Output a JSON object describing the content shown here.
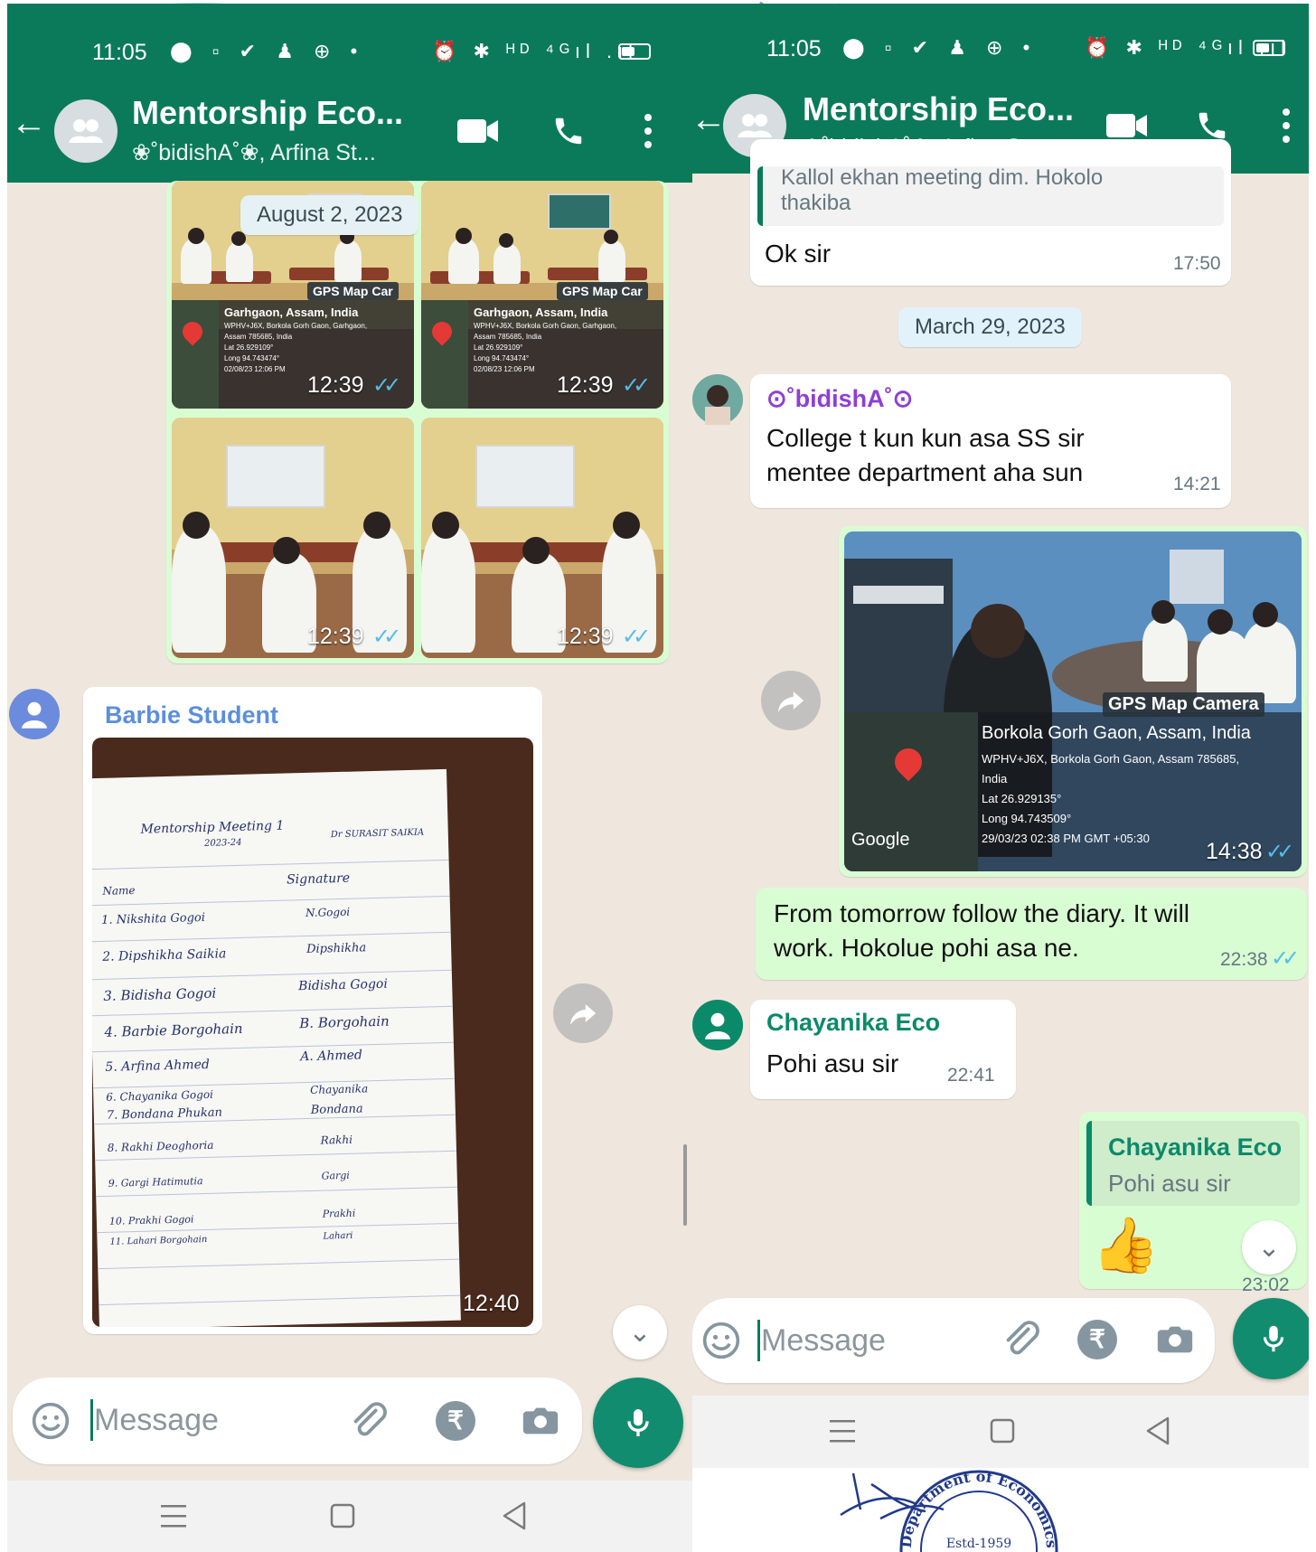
{
  "status": {
    "time": "11:05",
    "icons_left": "⬤ ▫ ✔ ♟ ⊕ •",
    "icons_right": "⏰ ✱ ᴴᴰ ⁴ᴳıl .ıl"
  },
  "chat": {
    "title": "Mentorship Eco...",
    "subtitle": "❀˚bidishA˚❀, Arfina St..."
  },
  "left": {
    "date_chip": "August 2, 2023",
    "photos": [
      {
        "time": "12:39",
        "gps_label": "GPS Map Car",
        "place": "Garhgaon, Assam, India",
        "line1": "WPHV+J6X, Borkola Gorh Gaon, Garhgaon,",
        "line2": "Assam 785685, India",
        "lat": "Lat 26.929109°",
        "long": "Long 94.743474°",
        "stamp": "02/08/23 12:06 PM"
      },
      {
        "time": "12:39",
        "gps_label": "GPS Map Car",
        "place": "Garhgaon, Assam, India",
        "line1": "WPHV+J6X, Borkola Gorh Gaon, Garhgaon,",
        "line2": "Assam 785685, India",
        "lat": "Lat 26.929109°",
        "long": "Long 94.743474°",
        "stamp": "02/08/23 12:06 PM"
      },
      {
        "time": "12:39"
      },
      {
        "time": "12:39"
      }
    ],
    "barbie": {
      "sender": "Barbie Student",
      "time": "12:40",
      "sheet": {
        "heading": "Mentorship Meeting 1",
        "year": "2023-24",
        "teacher": "Dr SURASIT SAIKIA",
        "col_name": "Name",
        "col_sign": "Signature",
        "rows": [
          {
            "name": "1. Nikshita Gogoi",
            "sign": "N.Gogoi"
          },
          {
            "name": "2. Dipshikha Saikia",
            "sign": "Dipshikha"
          },
          {
            "name": "3. Bidisha Gogoi",
            "sign": "Bidisha Gogoi"
          },
          {
            "name": "4. Barbie Borgohain",
            "sign": "B. Borgohain"
          },
          {
            "name": "5. Arfina Ahmed",
            "sign": "A. Ahmed"
          },
          {
            "name": "6. Chayanika Gogoi",
            "sign": "Chayanika"
          },
          {
            "name": "7. Bondana Phukan",
            "sign": "Bondana"
          },
          {
            "name": "8. Rakhi Deoghoria",
            "sign": "Rakhi"
          },
          {
            "name": "9. Gargi Hatimutia",
            "sign": "Gargi"
          },
          {
            "name": "10. Prakhi Gogoi",
            "sign": "Prakhi"
          },
          {
            "name": "11. Lahari Borgohain",
            "sign": "Lahari"
          }
        ]
      }
    },
    "input_placeholder": "Message"
  },
  "right": {
    "quoted_top": "Kallol ekhan meeting dim. Hokolo",
    "quoted_tail": "thakiba",
    "ok_text": "Ok sir",
    "ok_time": "17:50",
    "date_chip": "March 29, 2023",
    "bidisha": {
      "sender": "⊙˚bidishA˚⊙",
      "line1": "College t kun kun asa SS sir",
      "line2": "mentee department aha sun",
      "time": "14:21"
    },
    "gps_photo": {
      "label": "GPS Map Camera",
      "place": "Borkola Gorh Gaon, Assam, India",
      "line1": "WPHV+J6X, Borkola Gorh Gaon, Assam 785685,",
      "line2": "India",
      "lat": "Lat 26.929135°",
      "long": "Long 94.743509°",
      "stamp": "29/03/23 02:38 PM GMT +05:30",
      "google": "Google",
      "time": "14:38"
    },
    "diary": {
      "line1": "From tomorrow follow the diary. It will",
      "line2": "work. Hokolue pohi asa ne.",
      "time": "22:38"
    },
    "chayanika": {
      "sender": "Chayanika Eco",
      "text": "Pohi asu sir",
      "time": "22:41"
    },
    "reply": {
      "quoted_sender": "Chayanika Eco",
      "quoted_text": "Pohi asu sir",
      "emoji": "👍",
      "time": "23:02"
    },
    "input_placeholder": "Message"
  },
  "stamp": {
    "top": "Department of Economics",
    "estd": "Estd-1959"
  },
  "colors": {
    "header": "#0b7a5b",
    "chat_bg": "#efe7dd",
    "outgoing": "#d9fdd3",
    "tick_blue": "#53bdeb",
    "mic": "#128c6e"
  }
}
